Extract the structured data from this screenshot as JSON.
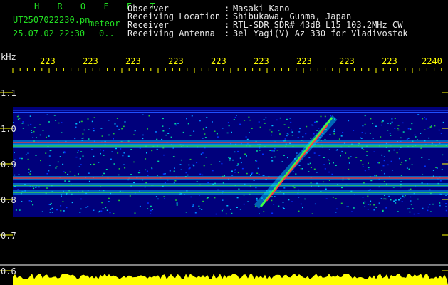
{
  "header": {
    "title": "H R O F F T",
    "filename": "UT2507022230.pn",
    "filename_suffix": "meteor",
    "datetime": "25.07.02 22:30",
    "counter": "0..",
    "fields": [
      {
        "label": "Observer",
        "value": "Masaki Kano"
      },
      {
        "label": "Receiving Location",
        "value": "Shibukawa, Gunma, Japan"
      },
      {
        "label": "Receiver",
        "value": "RTL-SDR SDR# 43dB L15 103.2MHz CW"
      },
      {
        "label": "Receiving Antenna",
        "value": "3el Yagi(V) Az 330 for Vladivostok"
      }
    ],
    "separator": ":"
  },
  "chart_data": {
    "type": "heatmap",
    "ylabel": "kHz",
    "x_tick_labels": [
      "223",
      "223",
      "223",
      "223",
      "223",
      "223",
      "223",
      "223",
      "223",
      "2240"
    ],
    "y_tick_labels": [
      "1.1",
      "1.0",
      "0.9",
      "0.8",
      "0.7",
      "0.6"
    ],
    "y_ticks": [
      1.1,
      1.0,
      0.9,
      0.8,
      0.7,
      0.6
    ],
    "ylim": [
      0.6,
      1.15
    ],
    "background_color": "#000088",
    "tick_color": "#ffff00",
    "meteor_echo": {
      "x_start": 0.56,
      "y_start": 0.78,
      "x_end": 0.74,
      "y_end": 1.03
    },
    "carriers": [
      0.96,
      0.95,
      0.86,
      0.84,
      0.82
    ]
  }
}
